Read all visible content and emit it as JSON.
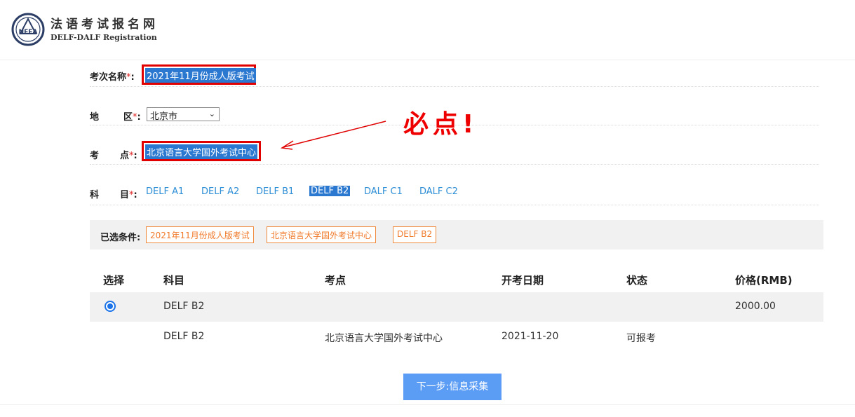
{
  "header": {
    "title": "法语考试报名网",
    "subtitle": "DELF-DALF Registration",
    "logo_text": "NEEA"
  },
  "form": {
    "exam_label": "考次名称",
    "exam_value": "2021年11月份成人版考试",
    "region_label_1": "地",
    "region_label_2": "区",
    "region_value": "北京市",
    "center_label_1": "考",
    "center_label_2": "点",
    "center_value": "北京语言大学国外考试中心",
    "subject_label_1": "科",
    "subject_label_2": "目",
    "required_mark": "*",
    "colon": ":",
    "subjects": [
      "DELF A1",
      "DELF A2",
      "DELF B1",
      "DELF B2",
      "DALF C1",
      "DALF C2"
    ],
    "selected_subject": "DELF B2"
  },
  "annotation": {
    "text": "必点!",
    "color": "#ee0000"
  },
  "conditions": {
    "label": "已选条件:",
    "tags": [
      "2021年11月份成人版考试",
      "北京语言大学国外考试中心",
      "DELF B2"
    ]
  },
  "table": {
    "headers": [
      "选择",
      "科目",
      "考点",
      "开考日期",
      "状态",
      "价格(RMB)"
    ],
    "rows": [
      {
        "selected": true,
        "subject": "DELF B2",
        "center": "",
        "date": "",
        "status": "",
        "price": "2000.00"
      },
      {
        "selected": false,
        "subject": "DELF B2",
        "center": "北京语言大学国外考试中心",
        "date": "2021-11-20",
        "status": "可报考",
        "price": ""
      }
    ]
  },
  "actions": {
    "next_label": "下一步:信息采集"
  },
  "colors": {
    "selection_bg": "#2b78d1",
    "link": "#2e8ed6",
    "tag_border": "#f08a3c",
    "button_bg": "#5b9df5",
    "highlight_box": "#e00000"
  }
}
